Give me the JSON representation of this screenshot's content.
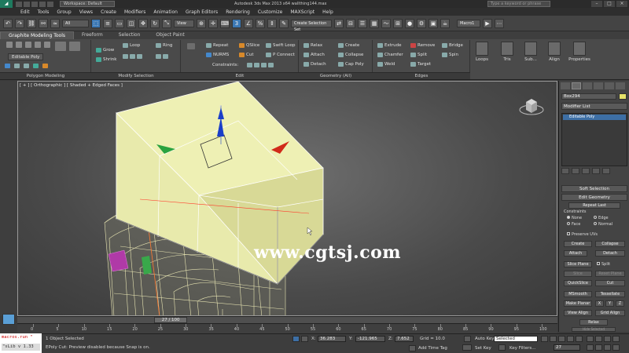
{
  "titlebar": {
    "workspace": "Workspace: Default",
    "app_title": "Autodesk 3ds Max 2013 x64      wallthing144.max",
    "search_placeholder": "Type a keyword or phrase"
  },
  "menu": [
    "Edit",
    "Tools",
    "Group",
    "Views",
    "Create",
    "Modifiers",
    "Animation",
    "Graph Editors",
    "Rendering",
    "Customize",
    "MAXScript",
    "Help"
  ],
  "toolbar": {
    "selection_filter": "All",
    "view_dropdown": "View",
    "named_selection": "Create Selection Set",
    "macro_label": "Macro1"
  },
  "ribbon": {
    "tabs": [
      "Graphite Modeling Tools",
      "Freeform",
      "Selection",
      "Object Paint"
    ],
    "active_tab": 0,
    "groups": {
      "polygon_modeling": "Polygon Modeling",
      "modify_selection": "Modify Selection",
      "edit": "Edit",
      "geometry": "Geometry (All)",
      "edges": "Edges",
      "loops": "Loops",
      "tris": "Tris",
      "subdivision": "Sub...",
      "align": "Align",
      "properties": "Properties"
    },
    "editable_poly_label": "Editable Poly",
    "modify_items": [
      "Grow",
      "Shrink",
      "Loop",
      "Ring"
    ],
    "edit_items": [
      "Repeat",
      "QSlice",
      "Swift Loop",
      "NURMS",
      "Cut",
      "P Connect",
      "Constraints:"
    ],
    "geometry_items": [
      "Relax",
      "Create",
      "Attach",
      "Collapse",
      "Detach",
      "Cap Poly"
    ],
    "edges_items": [
      "Extrude",
      "Remove",
      "Bridge",
      "Chamfer",
      "Split",
      "Spin",
      "Weld",
      "Target"
    ]
  },
  "viewport": {
    "label": "[ + ] [ Orthographic ] [ Shaded + Edged Faces ]",
    "watermark": "www.cgtsj.com",
    "gizmo_axis_label": "z"
  },
  "command_panel": {
    "object_name": "Box294",
    "object_color": "#e6e36a",
    "modifier_list": "Modifier List",
    "stack_entry": "Editable Poly",
    "soft_selection": "Soft Selection",
    "edit_geometry": "Edit Geometry",
    "repeat_last": "Repeat Last",
    "constraints": "Constraints",
    "constraint_options": [
      "None",
      "Edge",
      "Face",
      "Normal"
    ],
    "preserve_uvs": "Preserve UVs",
    "create": "Create",
    "collapse": "Collapse",
    "attach": "Attach",
    "detach": "Detach",
    "slice_plane": "Slice Plane",
    "split": "Split",
    "slice": "Slice",
    "reset_plane": "Reset Plane",
    "quickslice": "QuickSlice",
    "cut": "Cut",
    "msmooth": "MSmooth",
    "tessellate": "Tessellate",
    "make_planar": "Make Planar",
    "x": "X",
    "y": "Y",
    "z": "Z",
    "view_align": "View Align",
    "grid_align": "Grid Align",
    "relax": "Relax",
    "hide_selected": "Hide Selected"
  },
  "timeline": {
    "frame_display": "27 / 100",
    "current_frame": 27,
    "total_frames": 100,
    "ticks": [
      "0",
      "5",
      "10",
      "15",
      "20",
      "25",
      "30",
      "35",
      "40",
      "45",
      "50",
      "55",
      "60",
      "65",
      "70",
      "75",
      "80",
      "85",
      "90",
      "95",
      "100"
    ]
  },
  "status": {
    "maxscript_line1": "macros.run \"",
    "maxscript_line2": "\"sLib v 1.33",
    "selected": "1 Object Selected",
    "prompt": "EPoly Cut: Preview disabled because Snap is on.",
    "x_label": "X:",
    "x_value": "36.283",
    "y_label": "Y:",
    "y_value": "-121.965",
    "z_label": "Z:",
    "z_value": "7.652",
    "grid": "Grid = 10.0",
    "add_time_tag": "Add Time Tag",
    "auto_key": "Auto Key",
    "set_key": "Set Key",
    "selected_dropdown": "Selected",
    "key_filters": "Key Filters...",
    "frame_field": "27"
  }
}
